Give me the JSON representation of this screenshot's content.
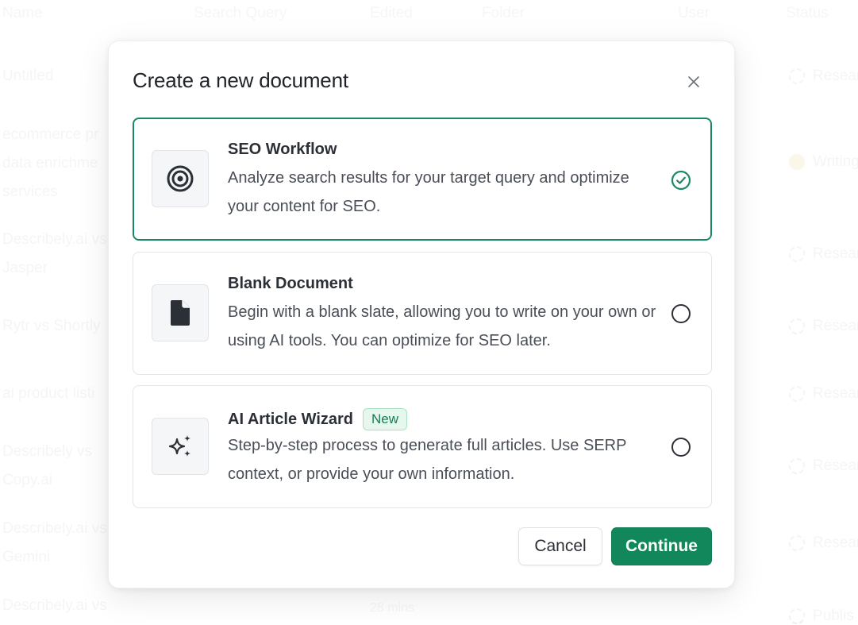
{
  "background": {
    "headers": [
      "Name",
      "Search Query",
      "Edited",
      "Folder",
      "User",
      "Status"
    ],
    "rows": [
      {
        "name": "Untitled",
        "status": "Resear"
      },
      {
        "name": "ecommerce pr",
        "name2": "data enrichme",
        "name3": "services",
        "status": "Writing"
      },
      {
        "name": "Describely.ai vs",
        "name2": "Jasper",
        "status": "Resear"
      },
      {
        "name": "Rytr vs Shortly",
        "status": "Resear"
      },
      {
        "name": "ai product listi",
        "status": "Resear"
      },
      {
        "name": "Describely vs",
        "name2": "Copy.ai",
        "status": "Resear"
      },
      {
        "name": "Describely.ai vs",
        "name2": "Gemini",
        "status": "Resear"
      },
      {
        "name": "Describely.ai vs",
        "edited": "28 mins",
        "status": "Publis"
      }
    ]
  },
  "modal": {
    "title": "Create a new document",
    "options": [
      {
        "title": "SEO Workflow",
        "description": "Analyze search results for your target query and optimize your content for SEO.",
        "icon": "target-icon",
        "selected": true
      },
      {
        "title": "Blank Document",
        "description": "Begin with a blank slate, allowing you to write on your own or using AI tools. You can optimize for SEO later.",
        "icon": "document-icon",
        "selected": false
      },
      {
        "title": "AI Article Wizard",
        "badge": "New",
        "description": "Step-by-step process to generate full articles. Use SERP context, or provide your own information.",
        "icon": "sparkles-icon",
        "selected": false
      }
    ],
    "cancel_label": "Cancel",
    "continue_label": "Continue"
  },
  "colors": {
    "accent": "#13875c",
    "selected_border": "#1a8a62",
    "badge_bg": "#e6f8ee",
    "badge_text": "#1a7a52"
  }
}
